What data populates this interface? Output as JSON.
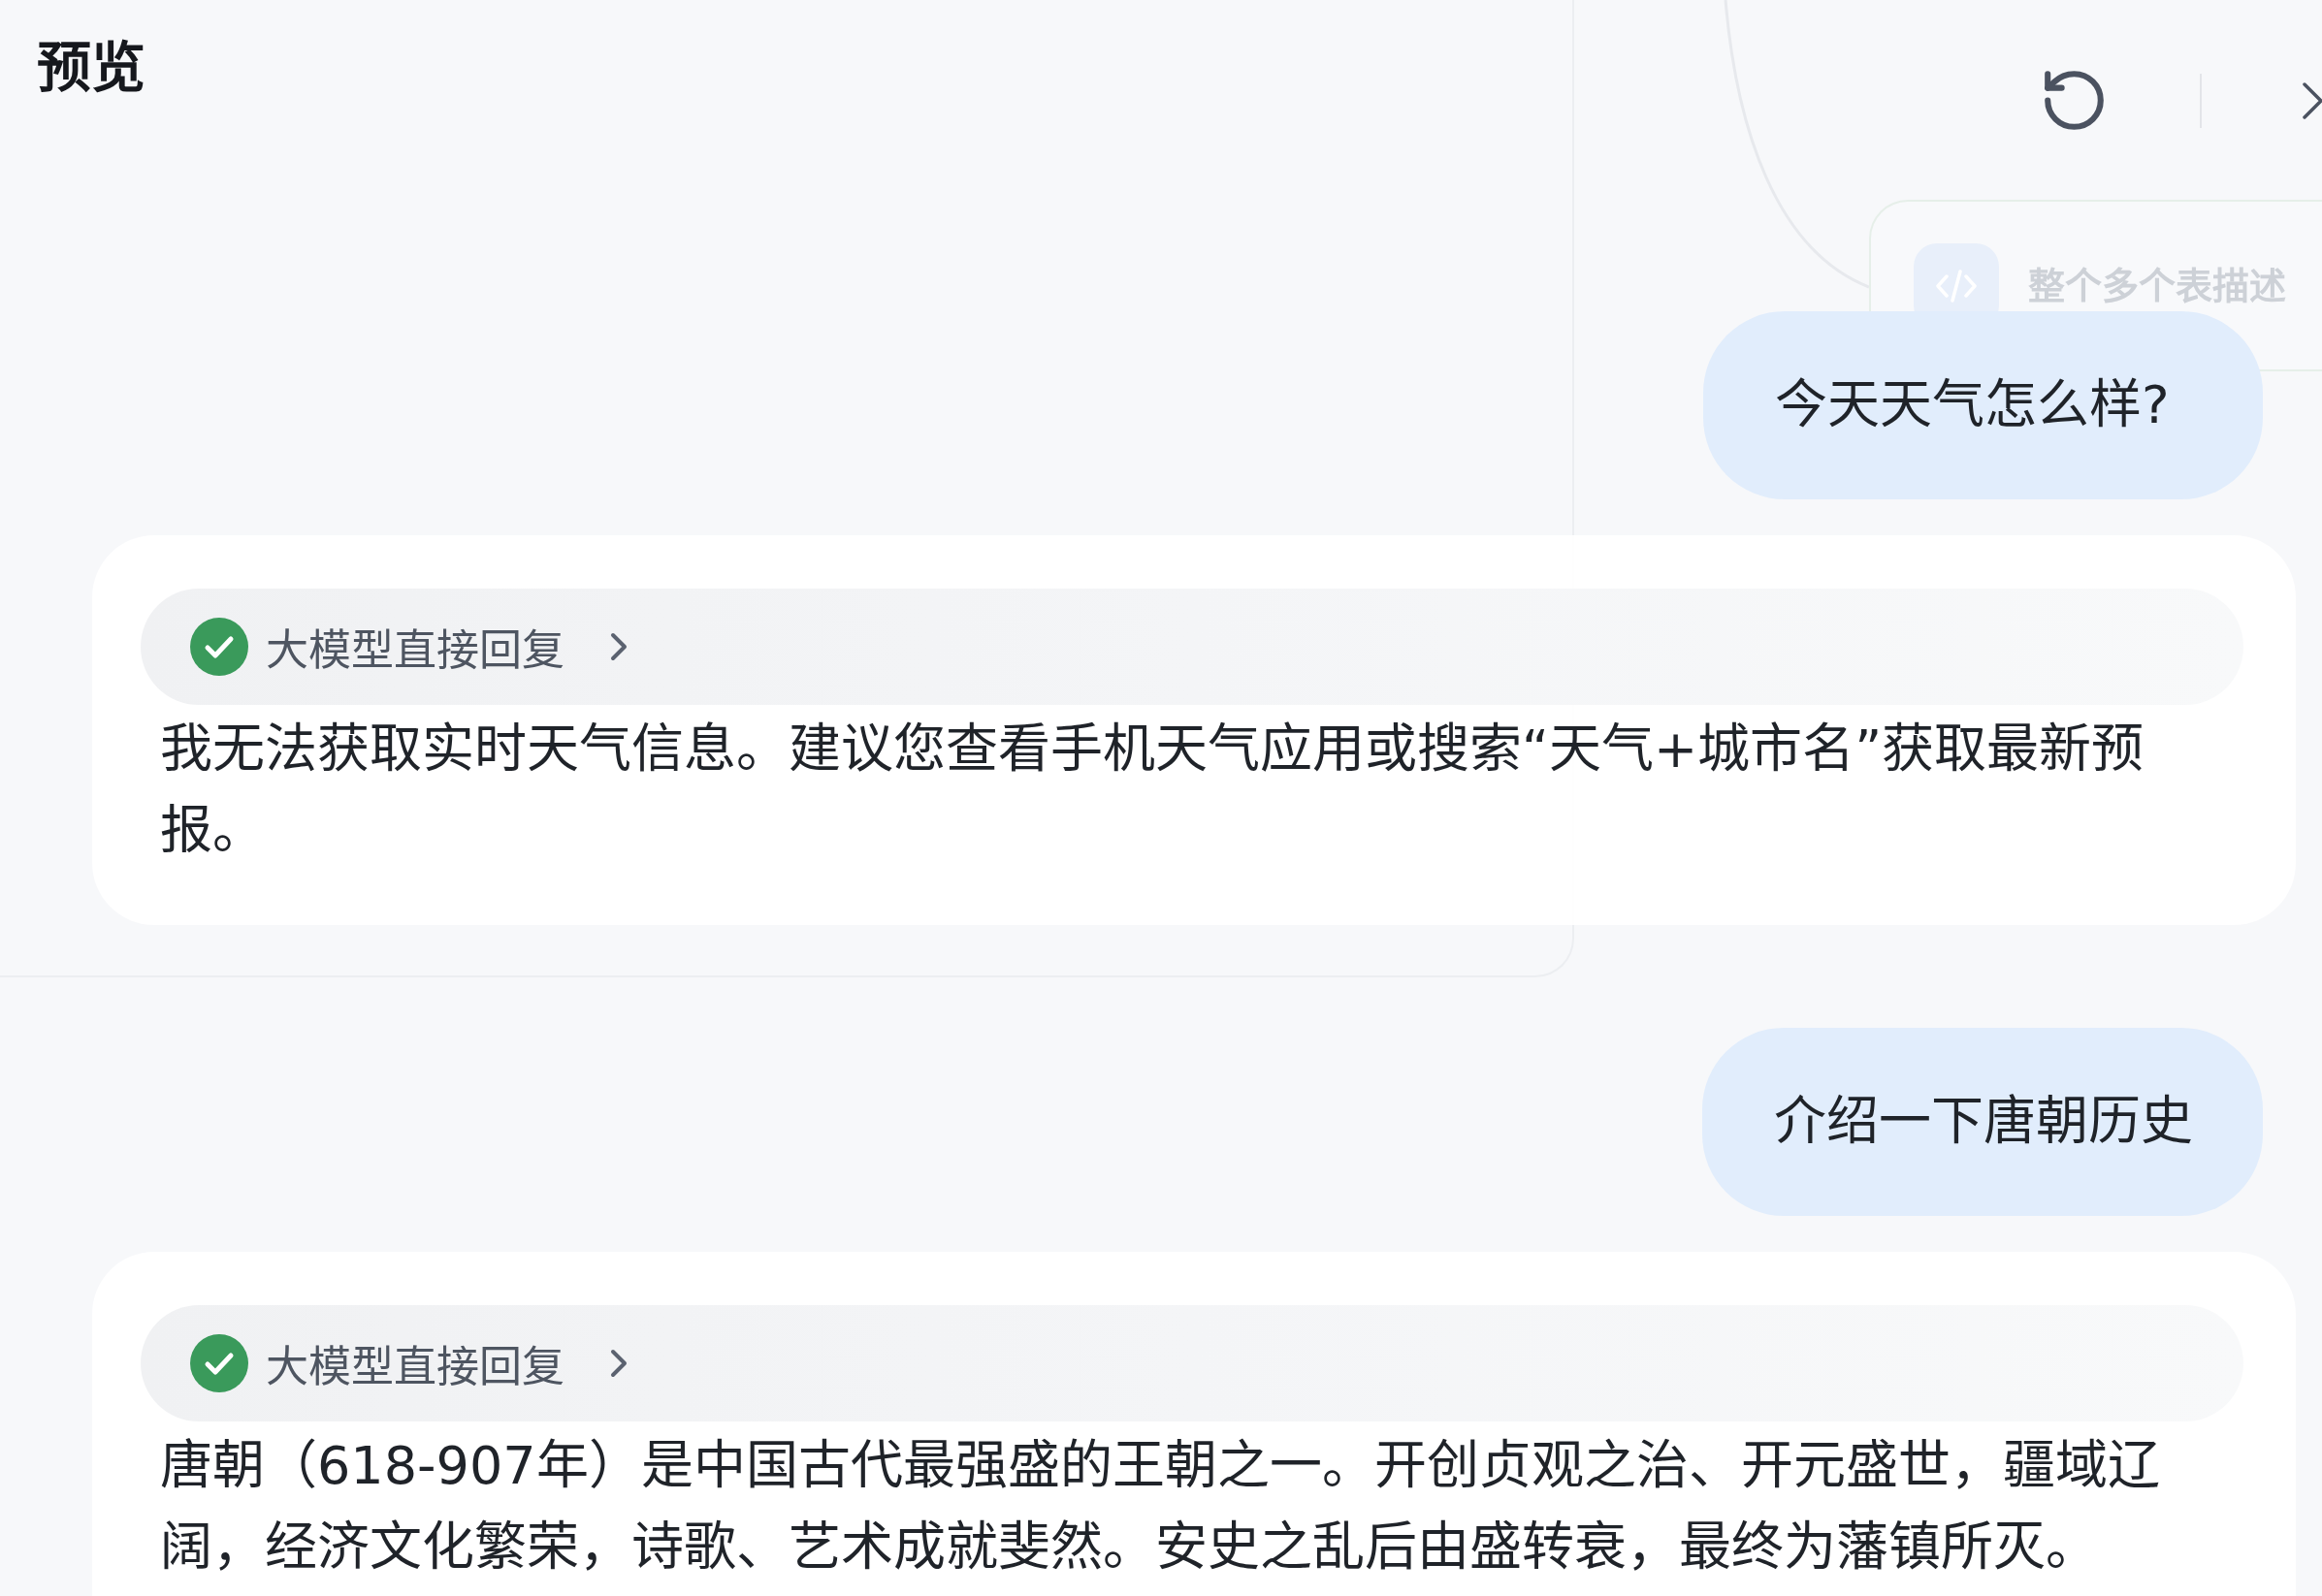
{
  "header": {
    "title": "预览"
  },
  "canvas_node": {
    "label": "整个多个表描述"
  },
  "messages": [
    {
      "kind": "user",
      "text": "今天天气怎么样?"
    },
    {
      "kind": "assistant",
      "status": {
        "label": "大模型直接回复",
        "done": true,
        "expanded": false
      },
      "text": "我无法获取实时天气信息。建议您查看手机天气应用或搜索“天气+城市名”获取最新预报。"
    },
    {
      "kind": "user",
      "text": "介绍一下唐朝历史"
    },
    {
      "kind": "assistant",
      "status": {
        "label": "大模型直接回复",
        "done": true,
        "expanded": false
      },
      "text": "唐朝（618-907年）是中国古代最强盛的王朝之一。开创贞观之治、开元盛世，疆域辽阔，经济文化繁荣，诗歌、艺术成就斐然。安史之乱后由盛转衰，最终为藩镇所灭。"
    }
  ]
}
